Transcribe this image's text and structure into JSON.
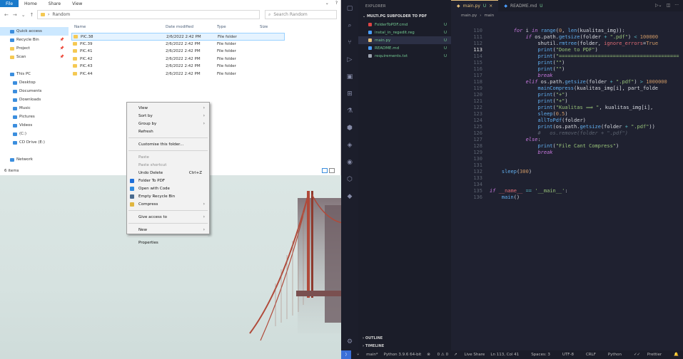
{
  "explorer": {
    "ribbon_tabs": [
      "File",
      "Home",
      "Share",
      "View"
    ],
    "path_sep": "›",
    "path": "Random",
    "search_placeholder": "Search Random",
    "nav": [
      {
        "label": "Quick access",
        "type": "blue",
        "sel": true
      },
      {
        "label": "Recycle Bin",
        "type": "blue",
        "pin": true
      },
      {
        "label": "Project",
        "type": "fold",
        "pin": true
      },
      {
        "label": "Scan",
        "type": "fold",
        "pin": true
      },
      {
        "label": "",
        "type": "none"
      },
      {
        "label": "This PC",
        "type": "blue"
      },
      {
        "label": "Desktop",
        "type": "blue",
        "indent": true
      },
      {
        "label": "Documents",
        "type": "blue",
        "indent": true
      },
      {
        "label": "Downloads",
        "type": "blue",
        "indent": true
      },
      {
        "label": "Music",
        "type": "blue",
        "indent": true
      },
      {
        "label": "Pictures",
        "type": "blue",
        "indent": true
      },
      {
        "label": "Videos",
        "type": "blue",
        "indent": true
      },
      {
        "label": "(C:)",
        "type": "blue",
        "indent": true
      },
      {
        "label": "CD Drive (E:)",
        "type": "blue",
        "indent": true
      },
      {
        "label": "",
        "type": "none"
      },
      {
        "label": "Network",
        "type": "blue"
      }
    ],
    "columns": {
      "name": "Name",
      "date": "Date modified",
      "type": "Type",
      "size": "Size"
    },
    "files": [
      {
        "name": "PIC.38",
        "date": "2/6/2022 2:42 PM",
        "type": "File folder"
      },
      {
        "name": "PIC.39",
        "date": "2/6/2022 2:42 PM",
        "type": "File folder"
      },
      {
        "name": "PIC.41",
        "date": "2/6/2022 2:42 PM",
        "type": "File folder"
      },
      {
        "name": "PIC.42",
        "date": "2/6/2022 2:42 PM",
        "type": "File folder"
      },
      {
        "name": "PIC.43",
        "date": "2/6/2022 2:42 PM",
        "type": "File folder"
      },
      {
        "name": "PIC.44",
        "date": "2/6/2022 2:42 PM",
        "type": "File folder"
      }
    ],
    "status": "6 items"
  },
  "context_menu": {
    "group1": [
      {
        "label": "View",
        "arrow": true
      },
      {
        "label": "Sort by",
        "arrow": true
      },
      {
        "label": "Group by",
        "arrow": true
      },
      {
        "label": "Refresh"
      }
    ],
    "group2": [
      {
        "label": "Customise this folder..."
      }
    ],
    "group3": [
      {
        "label": "Paste",
        "disabled": true
      },
      {
        "label": "Paste shortcut",
        "disabled": true
      },
      {
        "label": "Undo Delete",
        "shortcut": "Ctrl+Z"
      },
      {
        "label": "Folder To PDF",
        "icon": "#1e6fd9"
      },
      {
        "label": "Open with Code",
        "icon": "#2f8be0"
      },
      {
        "label": "Empty Recycle Bin",
        "icon": "#4a6b8f"
      },
      {
        "label": "Compress",
        "icon": "#e0b640",
        "arrow": true
      }
    ],
    "group4": [
      {
        "label": "Give access to",
        "arrow": true
      }
    ],
    "group5": [
      {
        "label": "New",
        "arrow": true
      }
    ],
    "group6": [
      {
        "label": "Properties"
      }
    ]
  },
  "vscode": {
    "explorer_title": "EXPLORER",
    "folder": "MULTI.PG SUBFOLDER TO PDF",
    "files": [
      {
        "name": "FolderToPDF.cmd",
        "u": "U",
        "color": "#d44"
      },
      {
        "name": "instal_in_regedit.reg",
        "u": "U",
        "color": "#4a9eff"
      },
      {
        "name": "main.py",
        "u": "U",
        "color": "#e5c07b",
        "sel": true
      },
      {
        "name": "README.md",
        "u": "U",
        "color": "#4a9eff"
      },
      {
        "name": "requirements.txt",
        "u": "U",
        "color": "#9ca3af"
      }
    ],
    "outline": "OUTLINE",
    "timeline": "TIMELINE",
    "tabs": [
      {
        "label": "main.py",
        "mark": "U",
        "active": true
      },
      {
        "label": "README.md",
        "mark": "U"
      }
    ],
    "crumb": [
      "main.py",
      "main"
    ],
    "statusbar": {
      "branch": "main*",
      "python": "Python 3.9.6 64-bit",
      "problems": "0 ⚠ 0",
      "live": "Live Share",
      "pos": "Ln 113, Col 41",
      "spaces": "Spaces: 3",
      "enc": "UTF-8",
      "eol": "CRLF",
      "lang": "Python",
      "prettier": "Prettier"
    }
  }
}
